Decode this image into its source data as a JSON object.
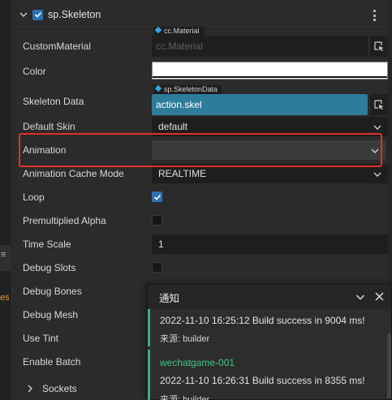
{
  "left_strip": {
    "menu_glyph": "≡",
    "orange_text": "es"
  },
  "component": {
    "title": "sp.Skeleton",
    "enabled": true,
    "more_icon": "kebab-icon"
  },
  "properties": {
    "custom_material": {
      "label": "CustomMaterial",
      "type_tag": "cc.Material",
      "placeholder": "cc.Material"
    },
    "color": {
      "label": "Color",
      "value": "#ffffff"
    },
    "skeleton_data": {
      "label": "Skeleton Data",
      "type_tag": "sp.SkeletonData",
      "value": "action.skel"
    },
    "default_skin": {
      "label": "Default Skin",
      "value": "default"
    },
    "animation": {
      "label": "Animation",
      "value": ""
    },
    "animation_cache_mode": {
      "label": "Animation Cache Mode",
      "value": "REALTIME"
    },
    "loop": {
      "label": "Loop",
      "checked": true
    },
    "premultiplied_alpha": {
      "label": "Premultiplied Alpha",
      "checked": false
    },
    "time_scale": {
      "label": "Time Scale",
      "value": "1"
    },
    "debug_slots": {
      "label": "Debug Slots",
      "checked": false
    },
    "debug_bones": {
      "label": "Debug Bones"
    },
    "debug_mesh": {
      "label": "Debug Mesh"
    },
    "use_tint": {
      "label": "Use Tint"
    },
    "enable_batch": {
      "label": "Enable Batch"
    },
    "sockets": {
      "label": "Sockets"
    }
  },
  "notification": {
    "title": "通知",
    "messages": [
      {
        "text": "2022-11-10 16:25:12 Build success in 9004 ms!",
        "source": "来源: builder"
      },
      {
        "name": "wechatgame-001",
        "text": "2022-11-10 16:26:31 Build success in 8355 ms!",
        "source": "来源: builder"
      }
    ]
  },
  "colors": {
    "accent_blue": "#2f6fb0",
    "asset_fill": "#2d7c9c",
    "highlight_red": "#e0302a",
    "success_green": "#40c787"
  }
}
